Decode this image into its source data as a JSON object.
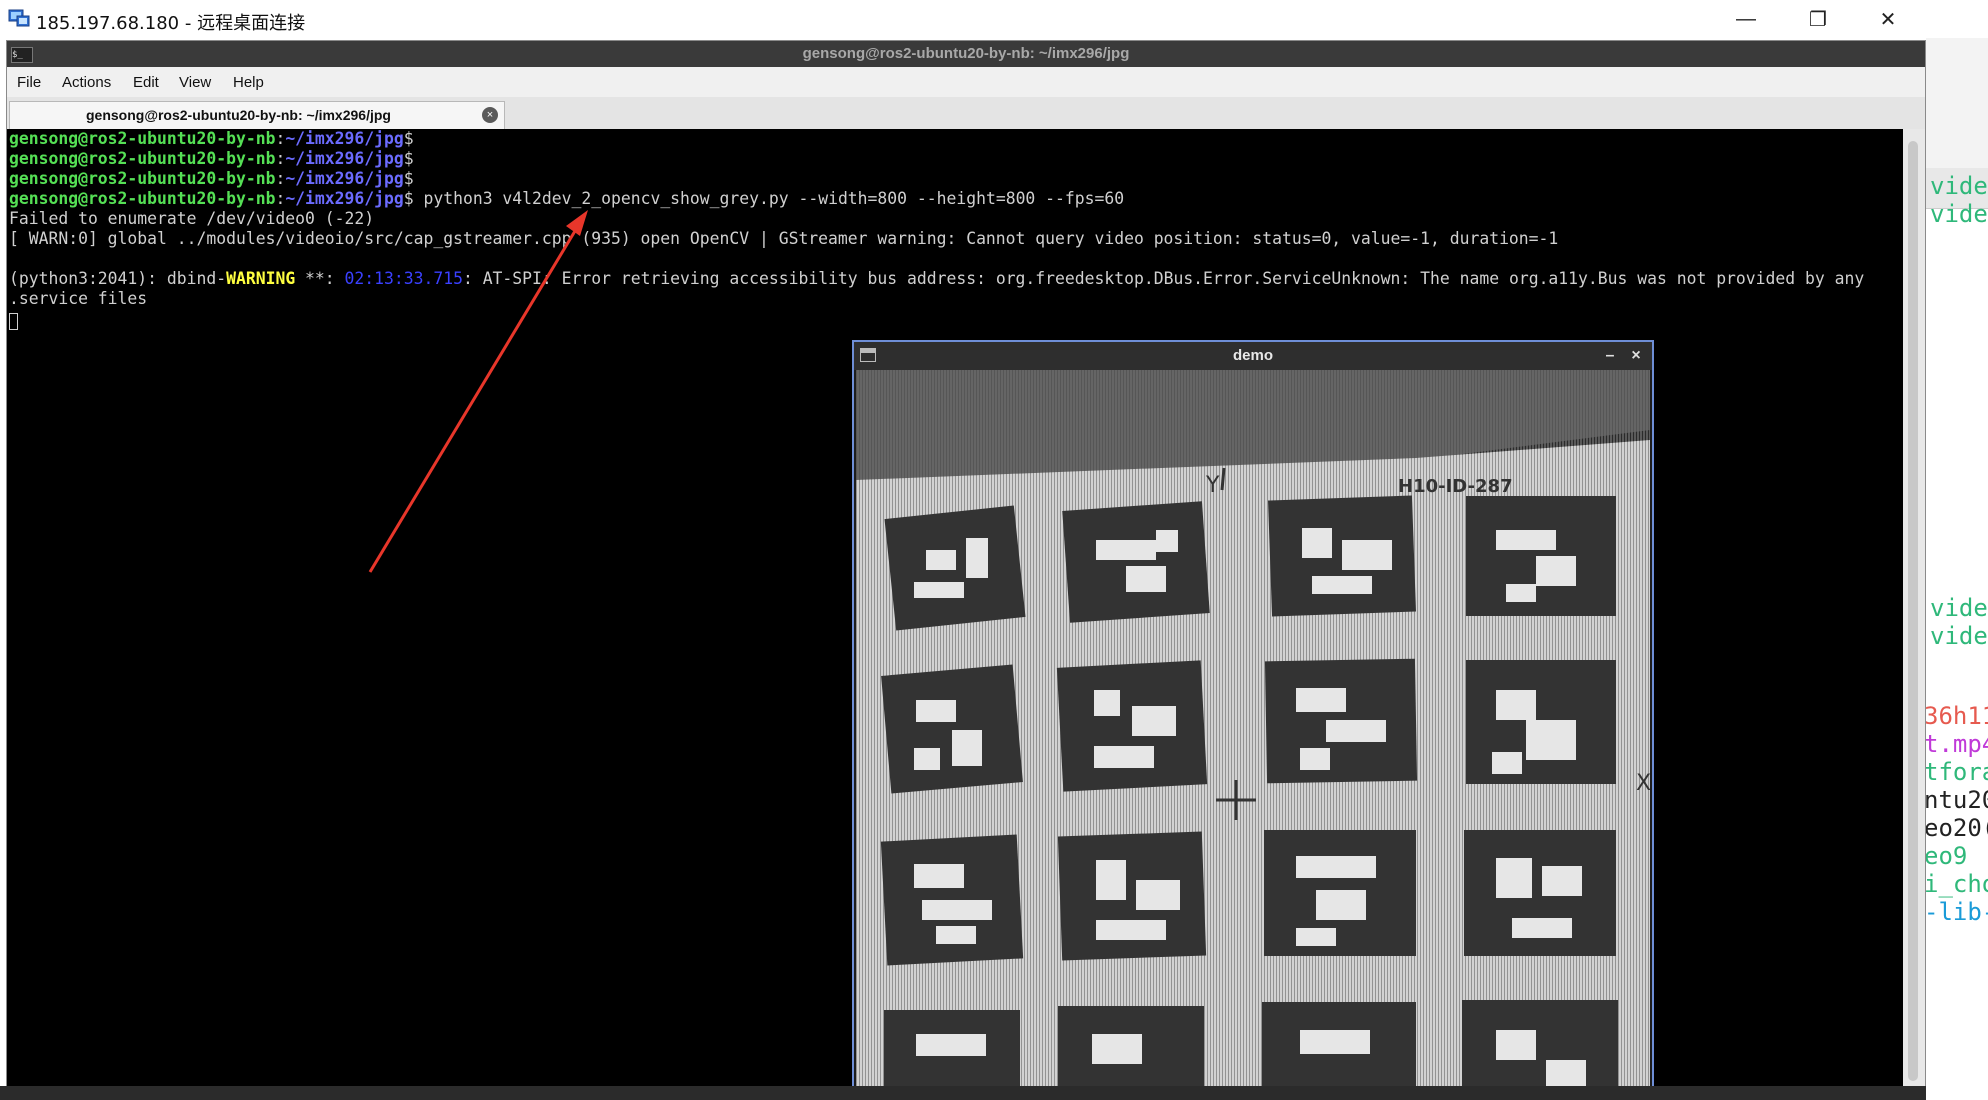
{
  "rdp": {
    "title": "185.197.68.180 - 远程桌面连接",
    "minimize_glyph": "—",
    "maximize_glyph": "❐",
    "close_glyph": "✕"
  },
  "terminal": {
    "title": "gensong@ros2-ubuntu20-by-nb: ~/imx296/jpg",
    "menu": [
      "File",
      "Actions",
      "Edit",
      "View",
      "Help"
    ],
    "tab_label": "gensong@ros2-ubuntu20-by-nb: ~/imx296/jpg",
    "tab_close_glyph": "×",
    "prompt_user": "gensong@ros2-ubuntu20-by-nb",
    "prompt_path": "~/imx296/jpg",
    "command": "python3 v4l2dev_2_opencv_show_grey.py --width=800 --height=800 --fps=60",
    "output": {
      "line1": "Failed to enumerate /dev/video0 (-22)",
      "line2": "[ WARN:0] global ../modules/videoio/src/cap_gstreamer.cpp (935) open OpenCV | GStreamer warning: Cannot query video position: status=0, value=-1, duration=-1",
      "line3_prefix": "(python3:2041): dbind-",
      "line3_warning": "WARNING",
      "line3_stars": " **: ",
      "line3_time": "02:13:33.715",
      "line3_rest": ": AT-SPI: Error retrieving accessibility bus address: org.freedesktop.DBus.Error.ServiceUnknown: The name org.a11y.Bus was not provided by any",
      "line4": ".service files"
    }
  },
  "demo_window": {
    "title": "demo",
    "minimize_glyph": "–",
    "close_glyph": "×",
    "board_label": "H10-ID-287",
    "axis_y": "Y",
    "axis_x": "X"
  },
  "right_partial": {
    "lines": [
      "vide",
      "vide",
      "vide",
      "vide",
      "36h11",
      "t.mp4",
      "tfora",
      "ntu20",
      "eo20(",
      "eo9",
      "i_cho",
      "-lib-"
    ],
    "colors": [
      "#2fb87a",
      "#2fb87a",
      "#2fb87a",
      "#2fb87a",
      "#e65a4f",
      "#c03ad8",
      "#2fb87a",
      "#222222",
      "#222222",
      "#2fb87a",
      "#2fb87a",
      "#1a9bd8"
    ]
  },
  "colors": {
    "prompt_user": "#55e055",
    "prompt_path": "#6b6bff",
    "annotation_arrow": "#e8362a"
  }
}
